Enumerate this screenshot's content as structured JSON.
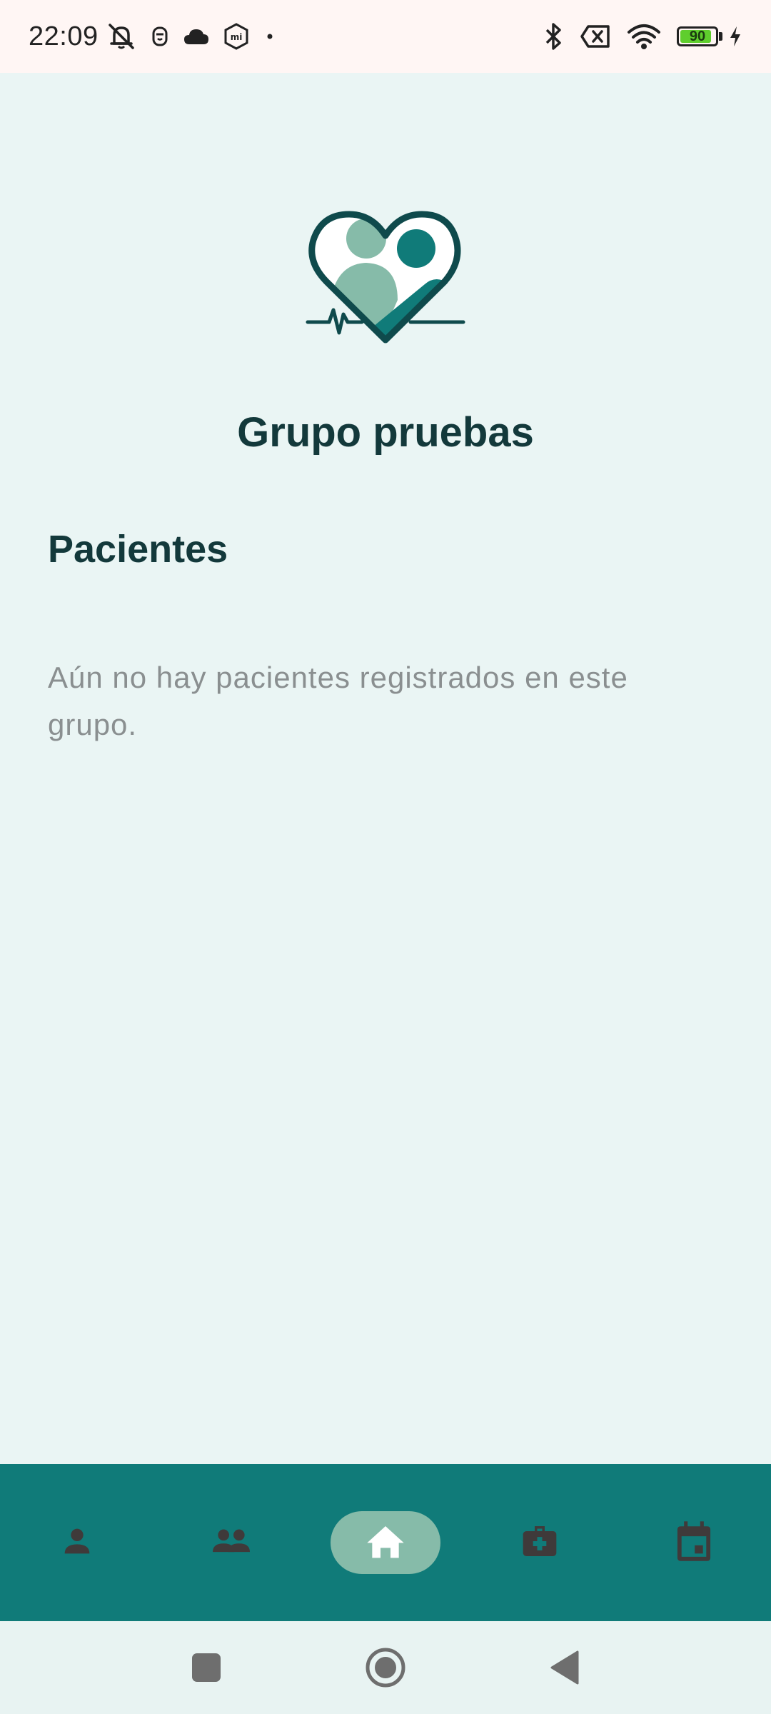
{
  "status_bar": {
    "time": "22:09",
    "left_icons": [
      "muted-bell-icon",
      "app-notification-icon",
      "cloud-icon",
      "mi-icon",
      "dot-icon"
    ],
    "right_icons": [
      "bluetooth-icon",
      "no-sim-icon",
      "wifi-icon",
      "battery-icon",
      "charging-icon"
    ],
    "battery_level": "90"
  },
  "main": {
    "group_title": "Grupo pruebas",
    "section_title": "Pacientes",
    "empty_message": "Aún no hay pacientes registrados en este grupo."
  },
  "bottom_nav": {
    "items": [
      {
        "icon": "person-icon",
        "active": false
      },
      {
        "icon": "people-icon",
        "active": false
      },
      {
        "icon": "home-icon",
        "active": true
      },
      {
        "icon": "medical-kit-icon",
        "active": false
      },
      {
        "icon": "calendar-icon",
        "active": false
      }
    ]
  },
  "colors": {
    "background": "#eaf5f4",
    "status_bar": "#fff6f4",
    "primary": "#107b79",
    "active_pill": "#86bba9",
    "title_text": "#13393b",
    "muted_text": "#8a8f90",
    "battery_fill": "#5fce2d"
  }
}
